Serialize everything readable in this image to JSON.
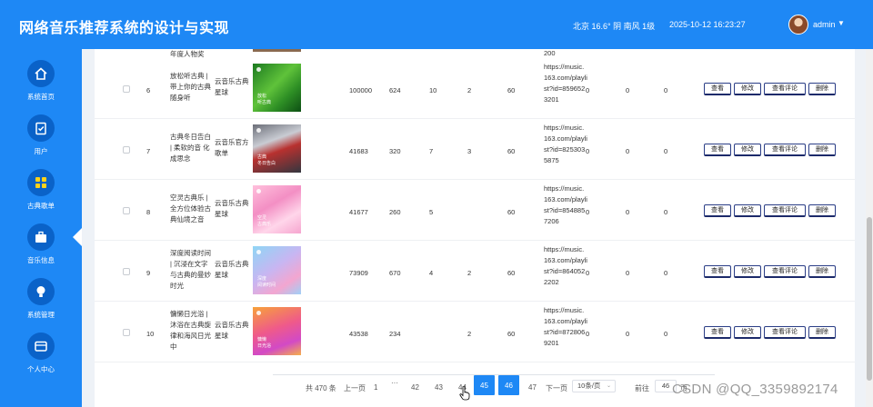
{
  "header": {
    "title": "网络音乐推荐系统的设计与实现",
    "weather": "北京 16.6° 阴 南风 1级",
    "datetime": "2025-10-12 16:23:27",
    "user": "admin"
  },
  "sidebar": {
    "items": [
      {
        "label": "系统首页",
        "icon": "home-icon"
      },
      {
        "label": "用户",
        "icon": "clipboard-icon"
      },
      {
        "label": "古典歌单",
        "icon": "grid-icon"
      },
      {
        "label": "音乐信息",
        "icon": "briefcase-icon"
      },
      {
        "label": "系统管理",
        "icon": "lightbulb-icon"
      },
      {
        "label": "个人中心",
        "icon": "card-icon"
      }
    ]
  },
  "partial_row": {
    "name_tail": "年度人物奖",
    "url_tail": "200"
  },
  "rows": [
    {
      "idx": "6",
      "name": "放松听古典 | 带上你的古典随身听",
      "author": "云音乐古典星球",
      "cover_caption": "放松\n听古典",
      "n1": "100000",
      "n2": "624",
      "n3": "10",
      "n4": "2",
      "n5": "60",
      "url": "https://music.163.com/playlist?id=8596523201",
      "z1": "0",
      "z2": "0",
      "z3": "0"
    },
    {
      "idx": "7",
      "name": "古典冬日告白 | 柔软的音 化成思念",
      "author": "云音乐官方歌单",
      "cover_caption": "古典\n冬日告白",
      "n1": "41683",
      "n2": "320",
      "n3": "7",
      "n4": "3",
      "n5": "60",
      "url": "https://music.163.com/playlist?id=8253035875",
      "z1": "0",
      "z2": "0",
      "z3": "0"
    },
    {
      "idx": "8",
      "name": "空灵古典乐 | 全方位体验古典仙境之音",
      "author": "云音乐古典星球",
      "cover_caption": "空灵\n古典乐",
      "n1": "41677",
      "n2": "260",
      "n3": "5",
      "n4": "",
      "n5": "60",
      "url": "https://music.163.com/playlist?id=8548857206",
      "z1": "0",
      "z2": "0",
      "z3": "0"
    },
    {
      "idx": "9",
      "name": "深度阅读时间 | 沉浸在文字与古典的曼妙时光",
      "author": "云音乐古典星球",
      "cover_caption": "深度\n阅读时间",
      "n1": "73909",
      "n2": "670",
      "n3": "4",
      "n4": "2",
      "n5": "60",
      "url": "https://music.163.com/playlist?id=8640522202",
      "z1": "0",
      "z2": "0",
      "z3": "0"
    },
    {
      "idx": "10",
      "name": "慵懒日光浴 | 沐浴在古典旋律和海风日光中",
      "author": "云音乐古典星球",
      "cover_caption": "慵懒\n日光浴",
      "n1": "43538",
      "n2": "234",
      "n3": "",
      "n4": "2",
      "n5": "60",
      "url": "https://music.163.com/playlist?id=8728069201",
      "z1": "0",
      "z2": "0",
      "z3": "0"
    }
  ],
  "actions": {
    "view": "查看",
    "edit": "修改",
    "view_comments": "查看评论",
    "delete": "删除"
  },
  "pagination": {
    "total": "共 470 条",
    "prev": "上一页",
    "first": "1",
    "ellipsis": "···",
    "pages": [
      "42",
      "43",
      "44",
      "45",
      "46",
      "47"
    ],
    "active": "45",
    "next": "下一页",
    "page_size": "10条/页",
    "goto_label": "前往",
    "goto_value": "46",
    "goto_suffix": "页"
  },
  "watermark": "CSDN @QQ_3359892174",
  "colors": {
    "primary": "#1e88f5",
    "nav_circle": "#0a62c8",
    "button_border": "#2a3d86"
  }
}
